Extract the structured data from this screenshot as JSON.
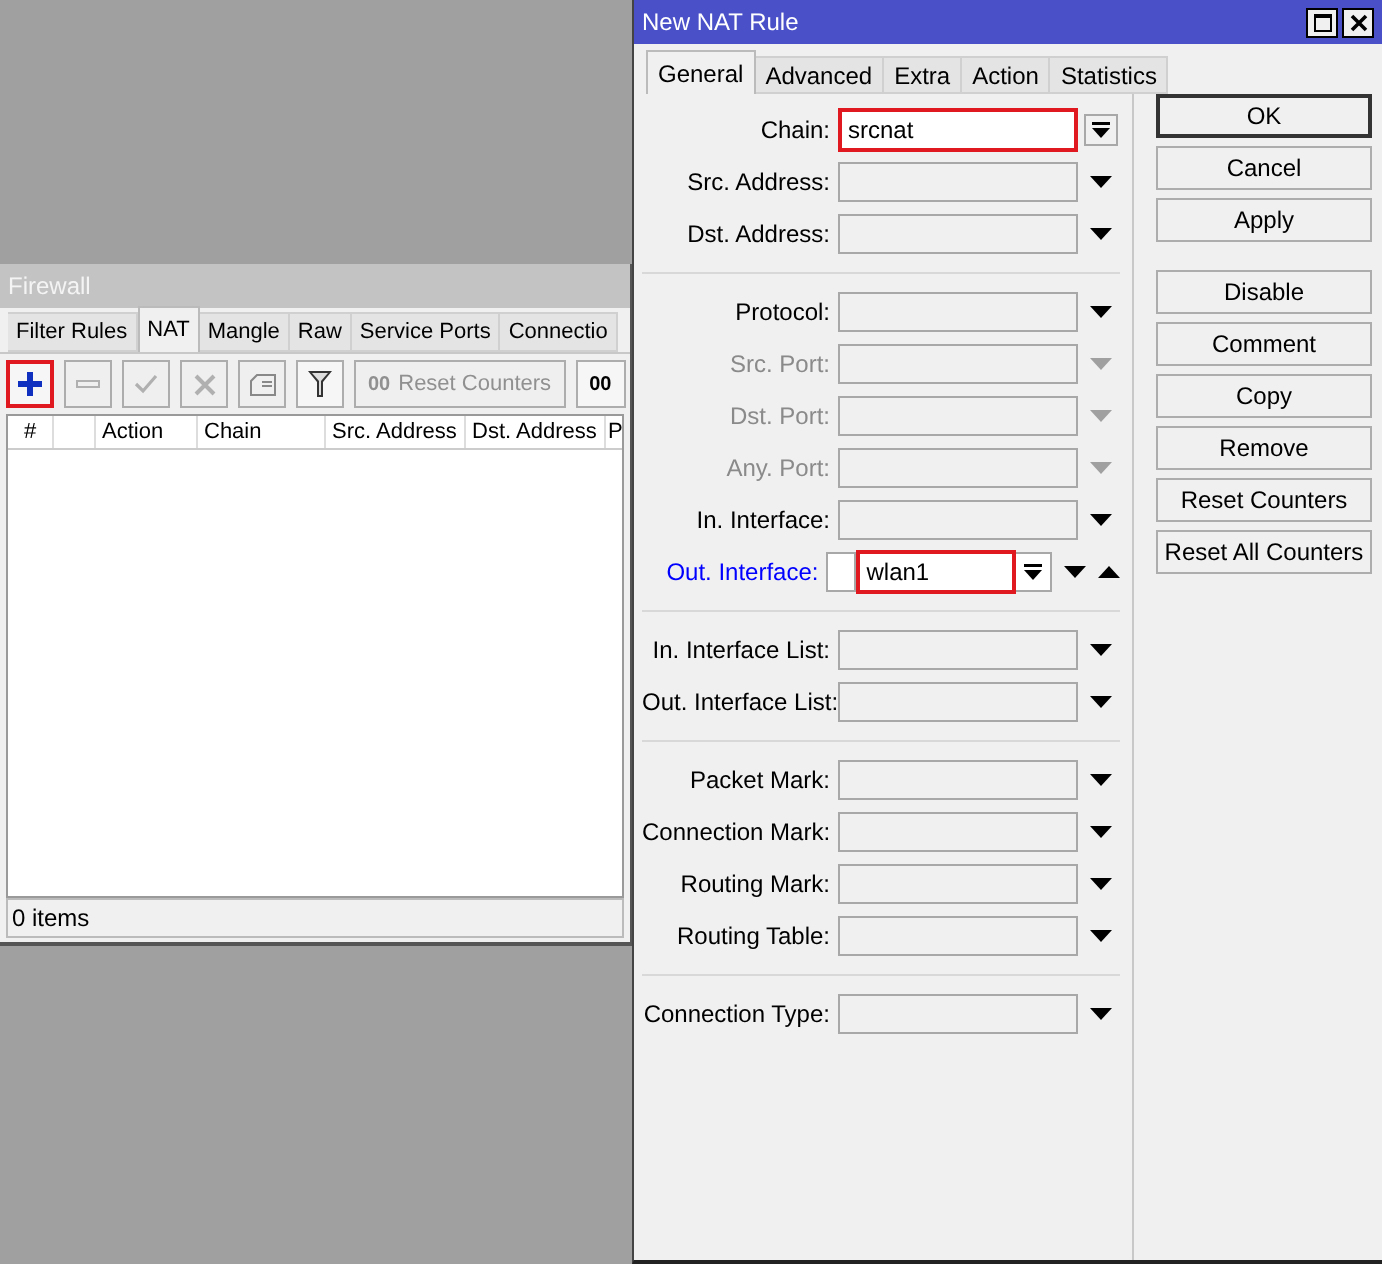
{
  "firewall": {
    "title": "Firewall",
    "tabs": [
      {
        "label": "Filter Rules",
        "selected": false
      },
      {
        "label": "NAT",
        "selected": true
      },
      {
        "label": "Mangle",
        "selected": false
      },
      {
        "label": "Raw",
        "selected": false
      },
      {
        "label": "Service Ports",
        "selected": false
      },
      {
        "label": "Connectio",
        "selected": false
      }
    ],
    "toolbar": [
      {
        "kind": "add",
        "highlighted": true,
        "disabled": false
      },
      {
        "kind": "remove",
        "highlighted": false,
        "disabled": true
      },
      {
        "kind": "enable",
        "highlighted": false,
        "disabled": true
      },
      {
        "kind": "disable",
        "highlighted": false,
        "disabled": true
      },
      {
        "kind": "comment",
        "highlighted": false,
        "disabled": true
      },
      {
        "kind": "filter",
        "highlighted": false,
        "disabled": false
      },
      {
        "kind": "text",
        "icon_text": "00",
        "label": "Reset Counters",
        "highlighted": false,
        "disabled": true
      },
      {
        "kind": "text",
        "icon_text": "00",
        "highlighted": false,
        "disabled": false
      }
    ],
    "columns": [
      {
        "label": "#"
      },
      {
        "label": "Action"
      },
      {
        "label": "Chain"
      },
      {
        "label": "Src. Address"
      },
      {
        "label": "Dst. Address"
      },
      {
        "label": "P"
      }
    ],
    "status": "0 items"
  },
  "dialog": {
    "title": "New NAT Rule",
    "tabs": [
      {
        "label": "General",
        "selected": true
      },
      {
        "label": "Advanced",
        "selected": false
      },
      {
        "label": "Extra",
        "selected": false
      },
      {
        "label": "Action",
        "selected": false
      },
      {
        "label": "Statistics",
        "selected": false
      }
    ],
    "sections": [
      {
        "fields": [
          {
            "label": "Chain:",
            "kind": "set",
            "value": "srcnat",
            "highlighted": true,
            "disabled": false,
            "active": false
          },
          {
            "label": "Src. Address:",
            "kind": "empty",
            "highlighted": false,
            "disabled": false,
            "active": false
          },
          {
            "label": "Dst. Address:",
            "kind": "empty",
            "highlighted": false,
            "disabled": false,
            "active": false
          }
        ]
      },
      {
        "fields": [
          {
            "label": "Protocol:",
            "kind": "empty",
            "highlighted": false,
            "disabled": false,
            "active": false
          },
          {
            "label": "Src. Port:",
            "kind": "empty",
            "highlighted": false,
            "disabled": true,
            "active": false
          },
          {
            "label": "Dst. Port:",
            "kind": "empty",
            "highlighted": false,
            "disabled": true,
            "active": false
          },
          {
            "label": "Any. Port:",
            "kind": "empty",
            "highlighted": false,
            "disabled": true,
            "active": false
          },
          {
            "label": "In. Interface:",
            "kind": "empty",
            "highlighted": false,
            "disabled": false,
            "active": false
          },
          {
            "label": "Out. Interface:",
            "kind": "negatable",
            "value": "wlan1",
            "negated": false,
            "highlighted": true,
            "disabled": false,
            "active": true
          }
        ]
      },
      {
        "fields": [
          {
            "label": "In. Interface List:",
            "kind": "empty",
            "highlighted": false,
            "disabled": false,
            "active": false
          },
          {
            "label": "Out. Interface List:",
            "kind": "empty",
            "highlighted": false,
            "disabled": false,
            "active": false
          }
        ]
      },
      {
        "fields": [
          {
            "label": "Packet Mark:",
            "kind": "empty",
            "highlighted": false,
            "disabled": false,
            "active": false
          },
          {
            "label": "Connection Mark:",
            "kind": "empty",
            "highlighted": false,
            "disabled": false,
            "active": false
          },
          {
            "label": "Routing Mark:",
            "kind": "empty",
            "highlighted": false,
            "disabled": false,
            "active": false
          },
          {
            "label": "Routing Table:",
            "kind": "empty",
            "highlighted": false,
            "disabled": false,
            "active": false
          }
        ]
      },
      {
        "fields": [
          {
            "label": "Connection Type:",
            "kind": "empty",
            "highlighted": false,
            "disabled": false,
            "active": false
          }
        ]
      }
    ],
    "button_groups": [
      {
        "buttons": [
          {
            "label": "OK",
            "default": true
          },
          {
            "label": "Cancel",
            "default": false
          },
          {
            "label": "Apply",
            "default": false
          }
        ]
      },
      {
        "buttons": [
          {
            "label": "Disable",
            "default": false
          },
          {
            "label": "Comment",
            "default": false
          },
          {
            "label": "Copy",
            "default": false
          },
          {
            "label": "Remove",
            "default": false
          },
          {
            "label": "Reset Counters",
            "default": false
          },
          {
            "label": "Reset All Counters",
            "default": false
          }
        ]
      }
    ]
  }
}
